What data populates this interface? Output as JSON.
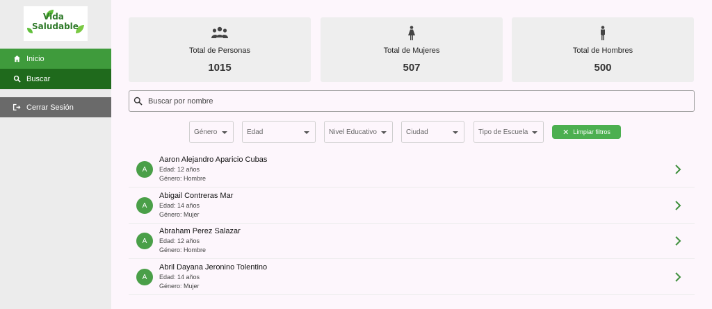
{
  "logo": {
    "line1": "Vida",
    "line2": "Saludable"
  },
  "sidebar": {
    "items": [
      {
        "label": "Inicio",
        "icon": "home-icon"
      },
      {
        "label": "Buscar",
        "icon": "search-icon"
      }
    ],
    "logout": {
      "label": "Cerrar Sesión",
      "icon": "logout-icon"
    }
  },
  "stats": [
    {
      "label": "Total de Personas",
      "value": "1015",
      "icon": "people-icon"
    },
    {
      "label": "Total de Mujeres",
      "value": "507",
      "icon": "woman-icon"
    },
    {
      "label": "Total de Hombres",
      "value": "500",
      "icon": "man-icon"
    }
  ],
  "search": {
    "placeholder": "Buscar por nombre",
    "value": ""
  },
  "filters": [
    {
      "label": "Género"
    },
    {
      "label": "Edad"
    },
    {
      "label": "Nivel Educativo"
    },
    {
      "label": "Ciudad"
    },
    {
      "label": "Tipo de Escuela"
    }
  ],
  "clear_filters": {
    "label": "Limpiar filtros"
  },
  "people": [
    {
      "initial": "A",
      "name": "Aaron Alejandro Aparicio Cubas",
      "age": "Edad: 12 años",
      "gender": "Género: Hombre"
    },
    {
      "initial": "A",
      "name": "Abigail Contreras Mar",
      "age": "Edad: 14 años",
      "gender": "Género: Mujer"
    },
    {
      "initial": "A",
      "name": "Abraham Perez Salazar",
      "age": "Edad: 12 años",
      "gender": "Género: Hombre"
    },
    {
      "initial": "A",
      "name": "Abril Dayana Jeronino Tolentino",
      "age": "Edad: 14 años",
      "gender": "Género: Mujer"
    }
  ],
  "colors": {
    "primary": "#3f9b3c",
    "primary_dark": "#1f6a1c",
    "logout": "#6a6a6a",
    "accent": "#4caf50"
  }
}
